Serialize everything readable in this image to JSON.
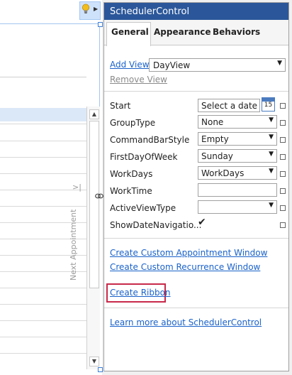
{
  "panel": {
    "title": "SchedulerControl",
    "tabs": [
      {
        "label": "General",
        "active": true
      },
      {
        "label": "Appearance",
        "active": false
      },
      {
        "label": "Behaviors",
        "active": false
      }
    ],
    "add_view_label": "Add View",
    "view_select_value": "DayView",
    "remove_view_label": "Remove View",
    "properties": [
      {
        "label": "Start",
        "value": "Select a date",
        "editor": "date"
      },
      {
        "label": "GroupType",
        "value": "None",
        "editor": "dropdown"
      },
      {
        "label": "CommandBarStyle",
        "value": "Empty",
        "editor": "dropdown"
      },
      {
        "label": "FirstDayOfWeek",
        "value": "Sunday",
        "editor": "dropdown"
      },
      {
        "label": "WorkDays",
        "value": "WorkDays",
        "editor": "dropdown"
      },
      {
        "label": "WorkTime",
        "value": "",
        "editor": "text"
      },
      {
        "label": "ActiveViewType",
        "value": "",
        "editor": "dropdown"
      },
      {
        "label": "ShowDateNavigatio...",
        "value": "✔",
        "editor": "checkbox"
      }
    ],
    "calendar_day": "15",
    "links": {
      "custom_appointment": "Create Custom Appointment Window",
      "custom_recurrence": "Create Custom Recurrence Window",
      "create_ribbon": "Create Ribbon",
      "learn_more": "Learn more about SchedulerControl"
    }
  },
  "designer": {
    "next_appointment": "Next Appointment",
    "nav_chevron": ">|"
  },
  "icons": {
    "lightbulb": "lightbulb-icon",
    "smart_tag_arrow": "chevron-right-icon",
    "calendar": "calendar-icon",
    "dropdown": "chevron-down-icon"
  },
  "colors": {
    "title_bar": "#2b579a",
    "link": "#1a62c9",
    "highlight_border": "#c8294a",
    "selection": "#a3c6f0"
  }
}
